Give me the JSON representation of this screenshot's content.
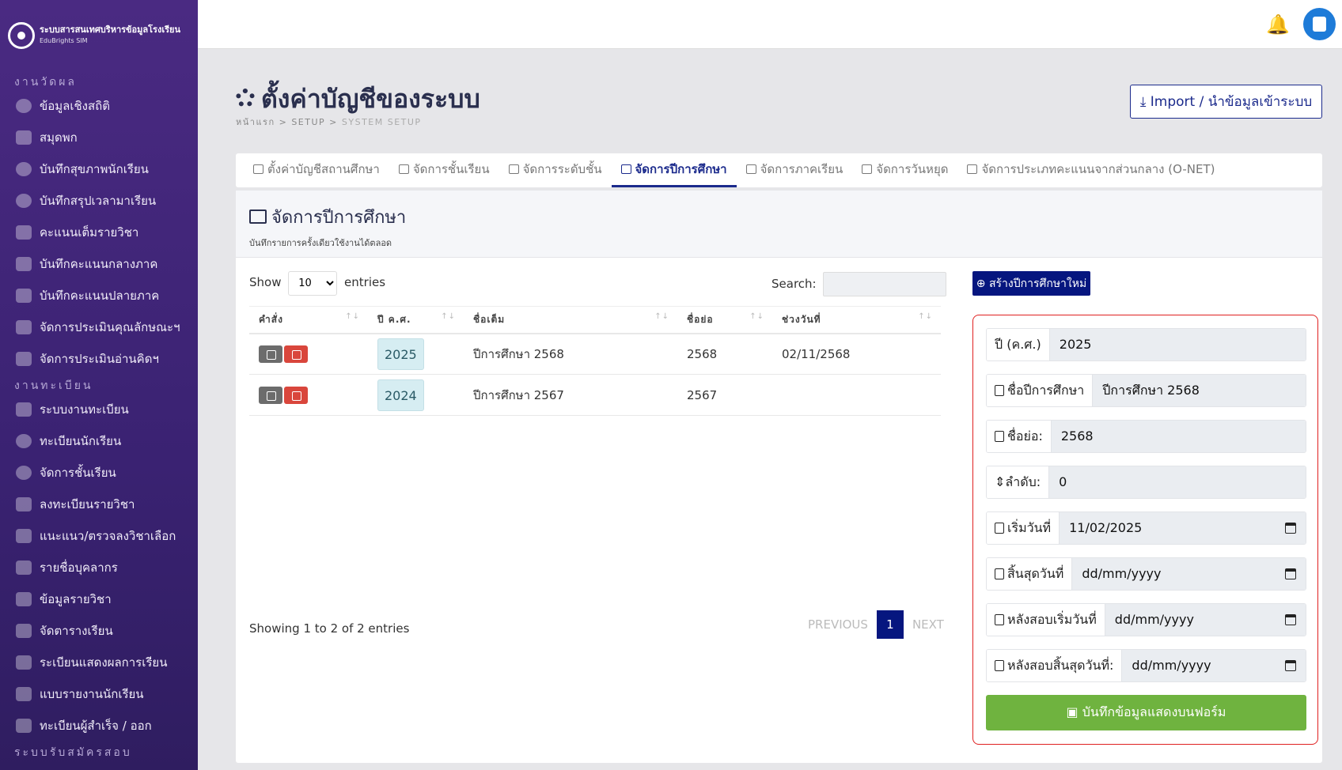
{
  "brand": {
    "name": "ระบบสารสนเทศบริหารข้อมูลโรงเรียน",
    "sub": "EduBrights SIM"
  },
  "sidebar": {
    "sections": [
      {
        "title": "งานวัดผล",
        "items": [
          "ข้อมูลเชิงสถิติ",
          "สมุดพก",
          "บันทึกสุขภาพนักเรียน",
          "บันทึกสรุปเวลามาเรียน",
          "คะแนนเต็มรายวิชา",
          "บันทึกคะแนนกลางภาค",
          "บันทึกคะแนนปลายภาค",
          "จัดการประเมินคุณลักษณะฯ",
          "จัดการประเมินอ่านคิดฯ"
        ]
      },
      {
        "title": "งานทะเบียน",
        "items": [
          "ระบบงานทะเบียน",
          "ทะเบียนนักเรียน",
          "จัดการชั้นเรียน",
          "ลงทะเบียนรายวิชา",
          "แนะแนว/ตรวจลงวิชาเลือก",
          "รายชื่อบุคลากร",
          "ข้อมูลรายวิชา",
          "จัดตารางเรียน",
          "ระเบียนแสดงผลการเรียน",
          "แบบรายงานนักเรียน",
          "ทะเบียนผู้สำเร็จ / ออก"
        ]
      },
      {
        "title": "ระบบรับสมัครสอบ",
        "items": []
      }
    ]
  },
  "header": {
    "title": "ตั้งค่าบัญชีของระบบ",
    "breadcrumb": [
      "หน้าแรก",
      "SETUP",
      "SYSTEM SETUP"
    ],
    "import_label": "Import / นำข้อมูลเข้าระบบ"
  },
  "tabs": [
    "ตั้งค่าบัญชีสถานศึกษา",
    "จัดการชั้นเรียน",
    "จัดการระดับชั้น",
    "จัดการปีการศึกษา",
    "จัดการภาคเรียน",
    "จัดการวันหยุด",
    "จัดการประเภทคะแนนจากส่วนกลาง (O-NET)"
  ],
  "active_tab": 3,
  "card": {
    "title": "จัดการปีการศึกษา",
    "subtitle": "บันทึกรายการครั้งเดียวใช้งานได้ตลอด"
  },
  "table": {
    "show_label": "Show",
    "entries_label": "entries",
    "page_size": "10",
    "search_label": "Search:",
    "columns": [
      "คำสั่ง",
      "ปี ค.ศ.",
      "ชื่อเต็ม",
      "ชื่อย่อ",
      "ช่วงวันที่"
    ],
    "rows": [
      {
        "year": "2025",
        "full": "ปีการศึกษา 2568",
        "short": "2568",
        "range": "02/11/2568"
      },
      {
        "year": "2024",
        "full": "ปีการศึกษา 2567",
        "short": "2567",
        "range": ""
      }
    ],
    "info": "Showing 1 to 2 of 2 entries",
    "pager": {
      "prev": "PREVIOUS",
      "page": "1",
      "next": "NEXT"
    }
  },
  "form": {
    "create_label": "สร้างปีการศึกษาใหม่",
    "fields": [
      {
        "label": "ปี (ค.ศ.)",
        "value": "2025"
      },
      {
        "label": "ชื่อปีการศึกษา",
        "value": "ปีการศึกษา 2568"
      },
      {
        "label": "ชื่อย่อ:",
        "value": "2568"
      },
      {
        "label": "ลำดับ:",
        "value": "0"
      },
      {
        "label": "เริ่มวันที่",
        "value": "11/02/2025"
      },
      {
        "label": "สิ้นสุดวันที่",
        "value": "dd/mm/yyyy"
      },
      {
        "label": "หลังสอบเริ่มวันที่",
        "value": "dd/mm/yyyy"
      },
      {
        "label": "หลังสอบสิ้นสุดวันที่:",
        "value": "dd/mm/yyyy"
      }
    ],
    "save_label": "บันทึกข้อมูลแสดงบนฟอร์ม"
  },
  "colors": {
    "sidebar": "#3a2272",
    "primary": "#06167f",
    "success": "#6fb33f",
    "danger": "#d9463c"
  }
}
